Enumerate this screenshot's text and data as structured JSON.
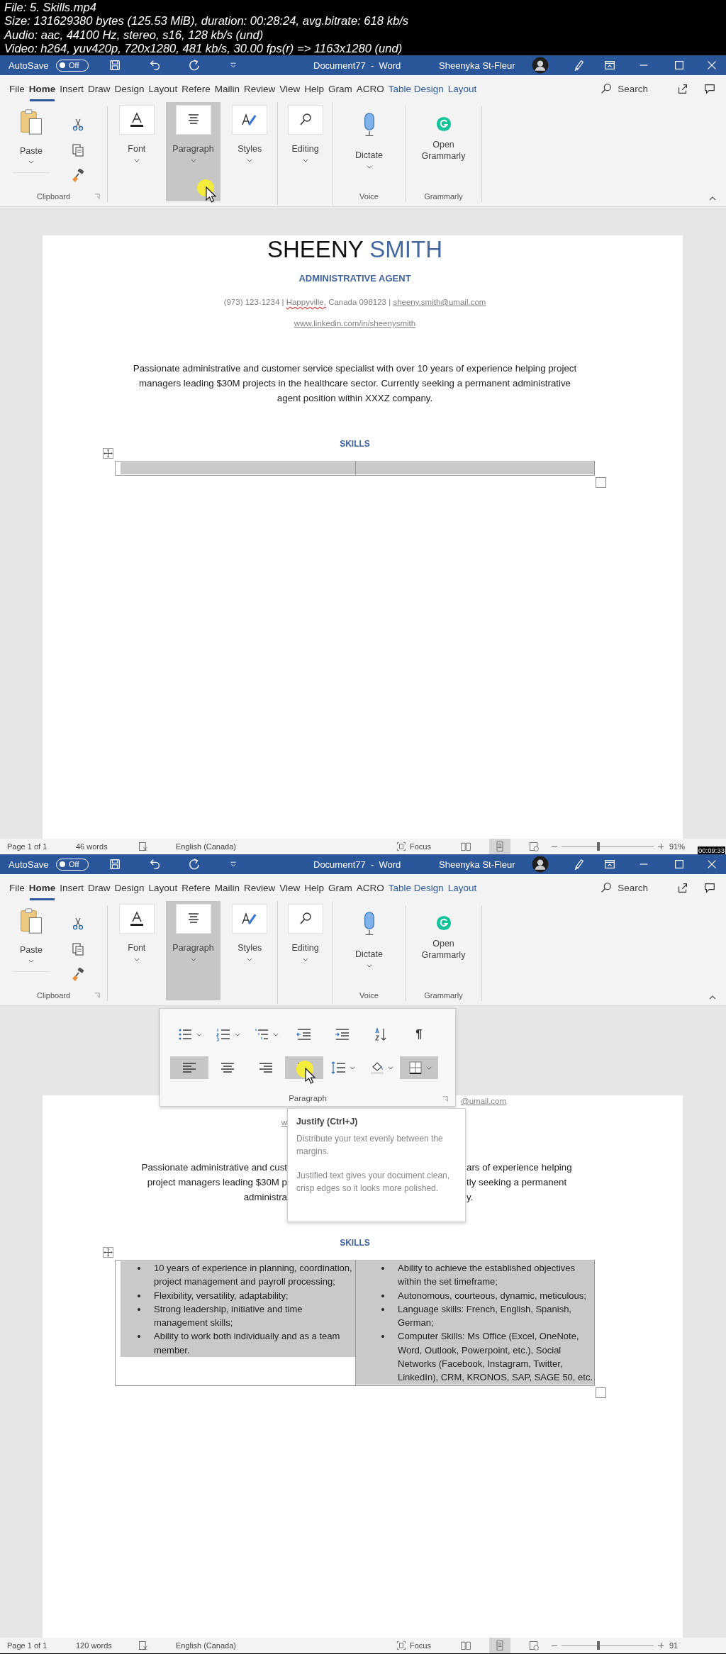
{
  "video_info": [
    "File: 5. Skills.mp4",
    "Size: 131629380 bytes (125.53 MiB), duration: 00:28:24, avg.bitrate: 618 kb/s",
    "Audio: aac, 44100 Hz, stereo, s16, 128 kb/s (und)",
    "Video: h264, yuv420p, 720x1280, 481 kb/s, 30.00 fps(r) => 1163x1280 (und)"
  ],
  "frames": [
    {
      "title_bar": {
        "autosave_label": "AutoSave",
        "autosave_state": "Off",
        "autosave_on": false,
        "document_title": "Document77  -  Word",
        "user_name": "Sheenyka St-Fleur"
      },
      "menu_tabs": [
        {
          "label": "File",
          "selected": false,
          "kind": "standard"
        },
        {
          "label": "Home",
          "selected": true,
          "kind": "standard"
        },
        {
          "label": "Insert",
          "selected": false,
          "kind": "standard"
        },
        {
          "label": "Draw",
          "selected": false,
          "kind": "standard"
        },
        {
          "label": "Design",
          "selected": false,
          "kind": "standard"
        },
        {
          "label": "Layout",
          "selected": false,
          "kind": "standard"
        },
        {
          "label": "Refere",
          "selected": false,
          "kind": "standard"
        },
        {
          "label": "Mailin",
          "selected": false,
          "kind": "standard"
        },
        {
          "label": "Review",
          "selected": false,
          "kind": "standard"
        },
        {
          "label": "View",
          "selected": false,
          "kind": "standard"
        },
        {
          "label": "Help",
          "selected": false,
          "kind": "standard"
        },
        {
          "label": "Gram",
          "selected": false,
          "kind": "standard"
        },
        {
          "label": "ACRO",
          "selected": false,
          "kind": "standard"
        },
        {
          "label": "Table Design",
          "selected": false,
          "kind": "contextual"
        },
        {
          "label": "Layout",
          "selected": false,
          "kind": "contextual"
        }
      ],
      "search_label": "Search",
      "ribbon": {
        "paste_label": "Paste",
        "clipboard_label": "Clipboard",
        "large_buttons": [
          {
            "label": "Font",
            "kind": "font",
            "selected": false,
            "hovered": false
          },
          {
            "label": "Paragraph",
            "kind": "paragraph",
            "selected": true,
            "hovered": true
          },
          {
            "label": "Styles",
            "kind": "styles",
            "selected": false,
            "hovered": false
          },
          {
            "label": "Editing",
            "kind": "editing",
            "selected": false,
            "hovered": false
          }
        ],
        "dictate_label": "Dictate",
        "voice_label": "Voice",
        "grammarly_button": "Open Grammarly",
        "grammarly_label": "Grammarly"
      },
      "document": {
        "kind": "full",
        "name_first": "SHEENY",
        "name_last": "SMITH",
        "job_title": "ADMINISTRATIVE AGENT",
        "contact": [
          {
            "text": "(973) 123-1234 |",
            "kind": "plain"
          },
          {
            "text": "Happyville,",
            "kind": "misspelled"
          },
          {
            "text": "Canada 098123 |",
            "kind": "plain"
          },
          {
            "text": "sheeny.smith@umail.com",
            "kind": "link"
          }
        ],
        "website": "www.linkedin.com/in/sheenysmith",
        "summary": "Passionate administrative and customer service specialist with over 10 years of experience helping project managers leading $30M projects in the healthcare sector. Currently seeking a permanent administrative agent position within XXXZ company.",
        "skills_heading": "SKILLS",
        "table": {
          "cells": [
            {
              "selected": true
            },
            {
              "selected": true
            }
          ]
        }
      },
      "status_bar": {
        "page": "Page 1 of 1",
        "words": "46 words",
        "language": "English (Canada)",
        "focus": "Focus",
        "views": [
          {
            "kind": "read",
            "selected": false
          },
          {
            "kind": "print",
            "selected": true
          },
          {
            "kind": "web",
            "selected": false
          }
        ],
        "zoom_slider": {
          "level": 0.4
        },
        "zoom": "91%"
      },
      "timestamp": "00:09:33"
    },
    {
      "title_bar": {
        "autosave_label": "AutoSave",
        "autosave_state": "Off",
        "autosave_on": false,
        "document_title": "Document77  -  Word",
        "user_name": "Sheenyka St-Fleur"
      },
      "menu_tabs": [
        {
          "label": "File",
          "selected": false,
          "kind": "standard"
        },
        {
          "label": "Home",
          "selected": true,
          "kind": "standard"
        },
        {
          "label": "Insert",
          "selected": false,
          "kind": "standard"
        },
        {
          "label": "Draw",
          "selected": false,
          "kind": "standard"
        },
        {
          "label": "Design",
          "selected": false,
          "kind": "standard"
        },
        {
          "label": "Layout",
          "selected": false,
          "kind": "standard"
        },
        {
          "label": "Refere",
          "selected": false,
          "kind": "standard"
        },
        {
          "label": "Mailin",
          "selected": false,
          "kind": "standard"
        },
        {
          "label": "Review",
          "selected": false,
          "kind": "standard"
        },
        {
          "label": "View",
          "selected": false,
          "kind": "standard"
        },
        {
          "label": "Help",
          "selected": false,
          "kind": "standard"
        },
        {
          "label": "Gram",
          "selected": false,
          "kind": "standard"
        },
        {
          "label": "ACRO",
          "selected": false,
          "kind": "standard"
        },
        {
          "label": "Table Design",
          "selected": false,
          "kind": "contextual"
        },
        {
          "label": "Layout",
          "selected": false,
          "kind": "contextual"
        }
      ],
      "search_label": "Search",
      "ribbon": {
        "paste_label": "Paste",
        "clipboard_label": "Clipboard",
        "large_buttons": [
          {
            "label": "Font",
            "kind": "font",
            "selected": false,
            "hovered": false
          },
          {
            "label": "Paragraph",
            "kind": "paragraph",
            "selected": true,
            "hovered": false
          },
          {
            "label": "Styles",
            "kind": "styles",
            "selected": false,
            "hovered": false
          },
          {
            "label": "Editing",
            "kind": "editing",
            "selected": false,
            "hovered": false
          }
        ],
        "dictate_label": "Dictate",
        "voice_label": "Voice",
        "grammarly_button": "Open Grammarly",
        "grammarly_label": "Grammarly"
      },
      "document": {
        "kind": "partial",
        "contact_fragment": "@umail.com",
        "website_fragment": "w",
        "summary_lines": [
          {
            "left": "Passionate administrative and cust",
            "right": "ars of experience helping"
          },
          {
            "left": "project managers leading $30M p",
            "right": "tly seeking a permanent"
          },
          {
            "left": "administra",
            "right": "y."
          }
        ],
        "skills_heading": "SKILLS",
        "table": {
          "cells": [
            {
              "selected": true,
              "items": [
                "10 years of experience in planning, coordination, project management and payroll processing;",
                "Flexibility, versatility, adaptability;",
                "Strong leadership, initiative and time management skills;",
                "Ability to work both individually and as a team member."
              ]
            },
            {
              "selected": true,
              "items": [
                "Ability to achieve the established objectives within the set timeframe;",
                "Autonomous, courteous, dynamic, meticulous;",
                "Language skills: French, English, Spanish, German;",
                "Computer Skills: Ms Office (Excel, OneNote, Word, Outlook, Powerpoint, etc.), Social Networks (Facebook, Instagram, Twitter, LinkedIn), CRM, KRONOS, SAP, SAGE 50, etc."
              ]
            }
          ]
        }
      },
      "popup": {
        "label": "Paragraph",
        "buttons": [
          {
            "kind": "bullets",
            "menu": true,
            "selected": false,
            "hovered": false
          },
          {
            "kind": "numbering",
            "menu": true,
            "selected": false,
            "hovered": false
          },
          {
            "kind": "multilevel",
            "menu": true,
            "selected": false,
            "hovered": false
          },
          {
            "kind": "outdent",
            "menu": false,
            "selected": false,
            "hovered": false
          },
          {
            "kind": "indent",
            "menu": false,
            "selected": false,
            "hovered": false
          },
          {
            "kind": "sort",
            "menu": false,
            "selected": false,
            "hovered": false
          },
          {
            "kind": "marks",
            "label": "¶",
            "menu": false,
            "selected": false,
            "hovered": false
          },
          {
            "kind": "align_left",
            "menu": false,
            "selected": true,
            "hovered": false
          },
          {
            "kind": "align_center",
            "menu": false,
            "selected": false,
            "hovered": false
          },
          {
            "kind": "align_right",
            "menu": false,
            "selected": false,
            "hovered": false
          },
          {
            "kind": "justify",
            "menu": false,
            "selected": true,
            "hovered": true
          },
          {
            "kind": "line_spacing",
            "menu": true,
            "selected": false,
            "hovered": false
          },
          {
            "kind": "shading",
            "menu": true,
            "selected": false,
            "hovered": false
          },
          {
            "kind": "borders",
            "menu": true,
            "selected": true,
            "hovered": false
          }
        ]
      },
      "tooltip": {
        "title": "Justify (Ctrl+J)",
        "paragraphs": [
          "Distribute your text evenly between the margins.",
          "Justified text gives your document clean, crisp edges so it looks more polished."
        ]
      },
      "status_bar": {
        "page": "Page 1 of 1",
        "words": "120 words",
        "language": "English (Canada)",
        "focus": "Focus",
        "views": [
          {
            "kind": "read",
            "selected": false
          },
          {
            "kind": "print",
            "selected": true
          },
          {
            "kind": "web",
            "selected": false
          }
        ],
        "zoom_slider": {
          "level": 0.4
        },
        "zoom": "91"
      }
    }
  ]
}
